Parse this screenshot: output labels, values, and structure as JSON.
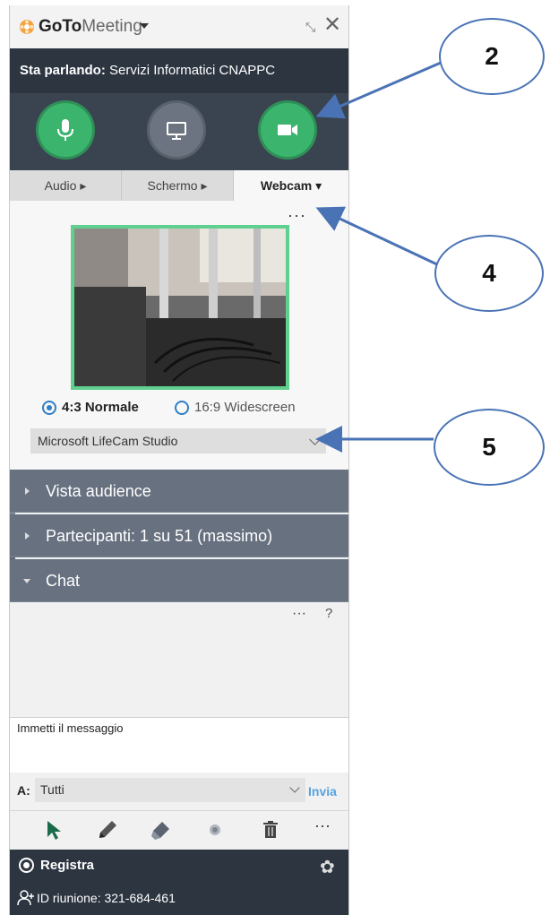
{
  "app": {
    "brand_bold": "GoTo",
    "brand_light": "Meeting"
  },
  "speaking": {
    "label": "Sta parlando:",
    "name": "Servizi Informatici CNAPPC"
  },
  "controls": {
    "mic": "microphone-icon",
    "screen": "screen-icon",
    "cam": "webcam-icon"
  },
  "tabs": [
    {
      "label": "Audio ▸"
    },
    {
      "label": "Schermo ▸"
    },
    {
      "label": "Webcam ▾"
    }
  ],
  "webcam": {
    "more": "···",
    "aspect_options": [
      {
        "label": "4:3 Normale",
        "selected": true
      },
      {
        "label": "16:9 Widescreen",
        "selected": false
      }
    ],
    "device": "Microsoft LifeCam Studio"
  },
  "sections": [
    {
      "label": "Vista audience",
      "expanded": false
    },
    {
      "label": "Partecipanti:  1 su 51 (massimo)",
      "expanded": false
    },
    {
      "label": "Chat",
      "expanded": true
    }
  ],
  "chat": {
    "more": "···",
    "help": "?",
    "message_placeholder": "Immetti il messaggio",
    "to_label": "A:",
    "to_value": "Tutti",
    "send_label": "Invia"
  },
  "toolbar": {
    "more": "···"
  },
  "footer": {
    "record_label": "Registra",
    "meeting_id": "ID riunione: 321-684-461"
  },
  "callouts": [
    "2",
    "4",
    "5"
  ],
  "colors": {
    "accent_green": "#3bb56d",
    "dark_bar": "#2d3541",
    "section_bg": "#687180",
    "callout_border": "#4a73b5"
  }
}
